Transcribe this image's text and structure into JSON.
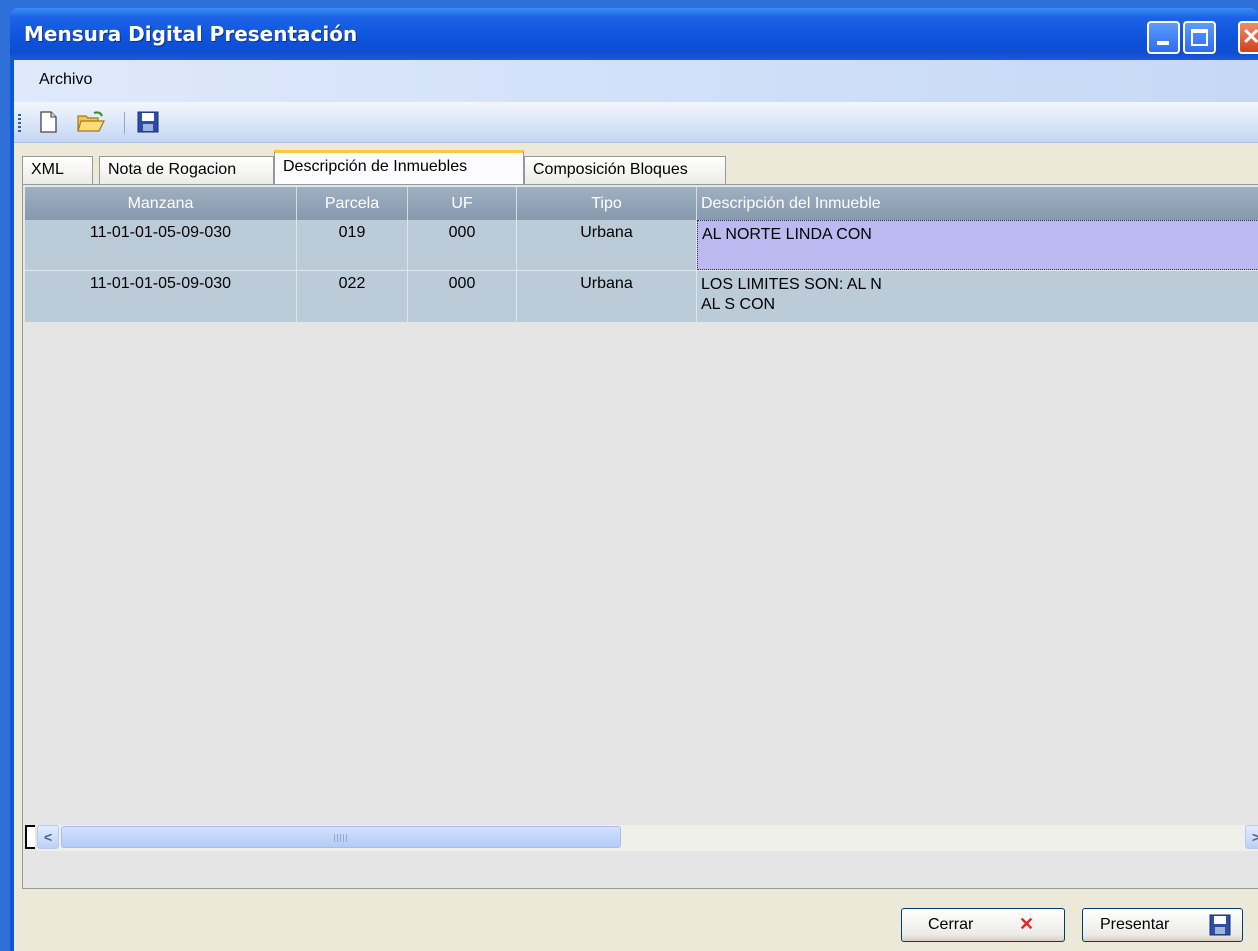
{
  "window": {
    "title": "Mensura Digital Presentación"
  },
  "menu": {
    "archivo": "Archivo"
  },
  "toolbar": {
    "new": "new-document-icon",
    "open": "open-folder-icon",
    "save": "save-icon"
  },
  "tabs": [
    {
      "label": "XML",
      "active": false
    },
    {
      "label": "Nota de Rogacion",
      "active": false
    },
    {
      "label": "Descripción de Inmuebles",
      "active": true
    },
    {
      "label": "Composición Bloques",
      "active": false
    }
  ],
  "grid": {
    "columns": [
      "Manzana",
      "Parcela",
      "UF",
      "Tipo",
      "Descripción del Inmueble"
    ],
    "rows": [
      {
        "manzana": "11-01-01-05-09-030",
        "parcela": "019",
        "uf": "000",
        "tipo": "Urbana",
        "descripcion": "AL NORTE LINDA CON",
        "selected": true
      },
      {
        "manzana": "11-01-01-05-09-030",
        "parcela": "022",
        "uf": "000",
        "tipo": "Urbana",
        "descripcion_lines": [
          "LOS LIMITES SON:  AL  N",
          "AL S  CON"
        ],
        "selected": false
      }
    ]
  },
  "buttons": {
    "cerrar": "Cerrar",
    "presentar": "Presentar"
  },
  "colors": {
    "title_bar": "#0f54de",
    "grid_header": "#8699ad",
    "grid_row": "#bccbd8",
    "selected_cell": "#bbbaf0",
    "active_tab_accent": "#ffc83c",
    "close_x": "#e3242b"
  }
}
